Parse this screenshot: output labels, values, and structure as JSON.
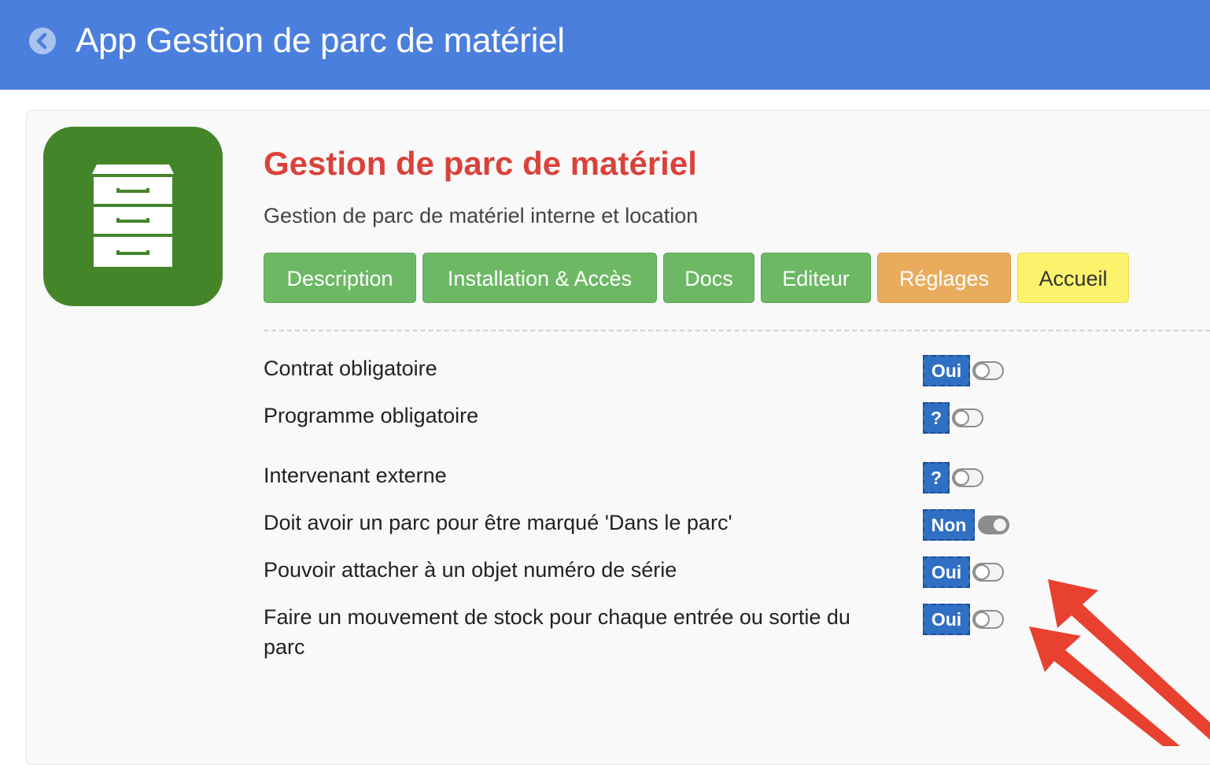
{
  "header": {
    "title": "App Gestion de parc de matériel",
    "back_icon": "chevron-left-circle-icon"
  },
  "module": {
    "title": "Gestion de parc de matériel",
    "subtitle": "Gestion de parc de matériel interne et location",
    "logo_icon": "filing-cabinet-icon",
    "title_color": "#d9423a"
  },
  "tabs": [
    {
      "label": "Description",
      "color": "#6cb865"
    },
    {
      "label": "Installation & Accès",
      "color": "#6cb865"
    },
    {
      "label": "Docs",
      "color": "#6cb865"
    },
    {
      "label": "Editeur",
      "color": "#6cb865"
    },
    {
      "label": "Réglages",
      "color": "#e9ac5d",
      "active": true
    },
    {
      "label": "Accueil",
      "color": "#fbf36b"
    }
  ],
  "settings": [
    {
      "label": "Contrat obligatoire",
      "badge": "Oui",
      "toggle_on": false
    },
    {
      "label": "Programme obligatoire",
      "badge": "?",
      "toggle_on": false
    },
    {
      "label": "Intervenant externe",
      "badge": "?",
      "toggle_on": false
    },
    {
      "label": "Doit avoir un parc pour être marqué 'Dans le parc'",
      "badge": "Non",
      "toggle_on": true
    },
    {
      "label": "Pouvoir attacher à un objet numéro de série",
      "badge": "Oui",
      "toggle_on": false
    },
    {
      "label": "Faire un mouvement de stock pour chaque entrée ou sortie du parc",
      "badge": "Oui",
      "toggle_on": false
    }
  ],
  "annotations": {
    "arrow_color": "#e8412f",
    "arrow_icon": "arrow-pointer-icon"
  },
  "colors": {
    "header_bg": "#4b7fdd",
    "badge_bg": "#2f6fc4",
    "logo_bg": "#44852a"
  }
}
